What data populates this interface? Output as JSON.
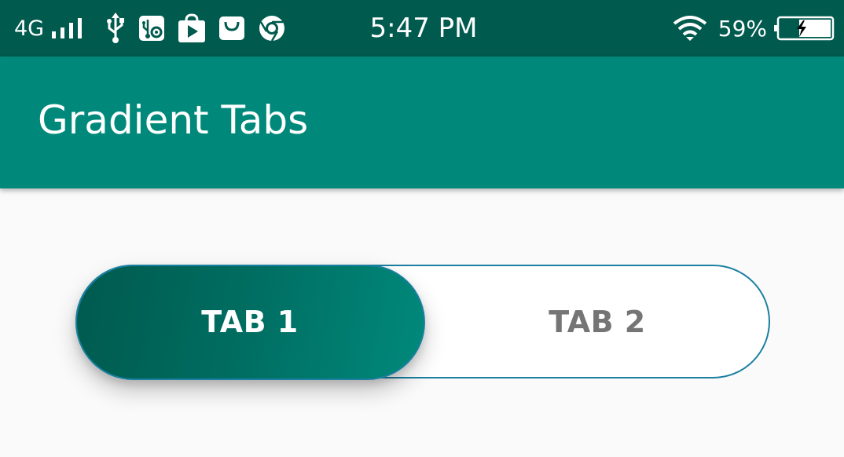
{
  "status_bar": {
    "network": "4G",
    "time": "5:47 PM",
    "battery_percent": "59%",
    "icons": [
      "signal-icon",
      "usb-icon",
      "usb-settings-icon",
      "play-store-icon",
      "shopping-bag-icon",
      "chrome-icon",
      "wifi-icon",
      "battery-charging-icon"
    ]
  },
  "app_bar": {
    "title": "Gradient Tabs"
  },
  "tabs": {
    "items": [
      {
        "label": "TAB 1",
        "selected": true
      },
      {
        "label": "TAB 2",
        "selected": false
      }
    ]
  },
  "colors": {
    "status_bar": "#005a4e",
    "app_bar": "#00897b",
    "tab_border": "#1a7fa0",
    "gradient_start": "#005a4e",
    "gradient_end": "#00897b",
    "unselected_text": "#757575",
    "background": "#fafafa"
  }
}
